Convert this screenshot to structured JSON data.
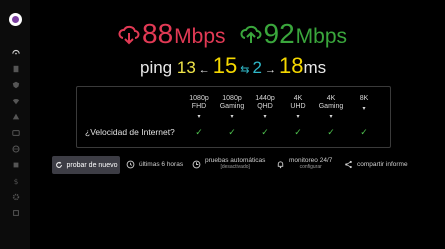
{
  "sidebar": {
    "items": [
      {
        "icon": "dashboard-icon"
      },
      {
        "icon": "document-icon"
      },
      {
        "icon": "shield-icon"
      },
      {
        "icon": "wifi-icon"
      },
      {
        "icon": "network-icon"
      },
      {
        "icon": "media-icon"
      },
      {
        "icon": "globe-icon"
      },
      {
        "icon": "layers-icon"
      },
      {
        "icon": "dollar-icon"
      },
      {
        "icon": "gear-icon"
      },
      {
        "icon": "square-icon"
      }
    ]
  },
  "speed": {
    "download_value": "88",
    "download_unit": "Mbps",
    "upload_value": "92",
    "upload_unit": "Mbps",
    "download_color": "#e23a55",
    "upload_color": "#3aa63c"
  },
  "ping": {
    "label": "ping",
    "unloaded": "13",
    "loaded": "15",
    "jitter": "2",
    "upload_latency": "18",
    "unit": "ms"
  },
  "quality": {
    "question": "¿Velocidad de Internet?",
    "columns": [
      {
        "line1": "1080p",
        "line2": "FHD"
      },
      {
        "line1": "1080p",
        "line2": "Gaming"
      },
      {
        "line1": "1440p",
        "line2": "QHD"
      },
      {
        "line1": "4K",
        "line2": "UHD"
      },
      {
        "line1": "4K",
        "line2": "Gaming"
      },
      {
        "line1": "8K",
        "line2": ""
      }
    ],
    "caret": "▾",
    "check": "✓",
    "check_color": "#4fc24f"
  },
  "actions": {
    "retry": "probar de nuevo",
    "history": "últimas 6 horas",
    "auto_tests": "pruebas automáticas",
    "auto_tests_sub": "[desactivado]",
    "monitor": "monitoreo 24/7",
    "monitor_sub": "configurar",
    "share": "compartir informe"
  }
}
